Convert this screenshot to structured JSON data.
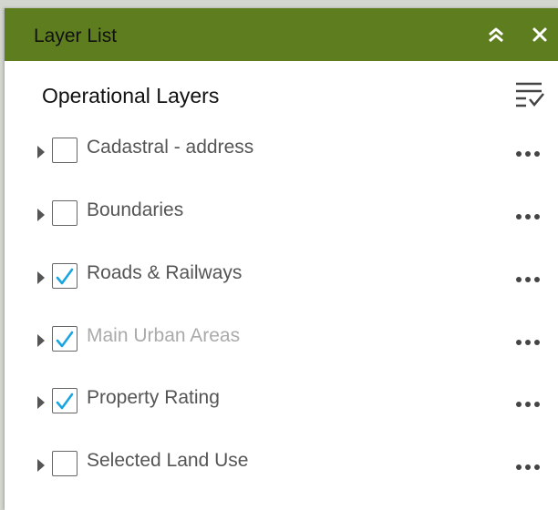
{
  "header": {
    "title": "Layer List",
    "collapse_icon": "chevron-double-up-icon",
    "close_icon": "close-icon",
    "bg_color": "#5e7d1f"
  },
  "section": {
    "title": "Operational Layers",
    "options_icon": "layer-options-icon"
  },
  "layers": [
    {
      "label": "Cadastral - address",
      "checked": false,
      "dimmed": false
    },
    {
      "label": "Boundaries",
      "checked": false,
      "dimmed": false
    },
    {
      "label": "Roads & Railways",
      "checked": true,
      "dimmed": false
    },
    {
      "label": "Main Urban Areas",
      "checked": true,
      "dimmed": true
    },
    {
      "label": "Property Rating",
      "checked": true,
      "dimmed": false
    },
    {
      "label": "Selected Land Use",
      "checked": false,
      "dimmed": false
    }
  ],
  "colors": {
    "check": "#1aa5e0",
    "text": "#555555",
    "text_dimmed": "#aaaaaa"
  }
}
